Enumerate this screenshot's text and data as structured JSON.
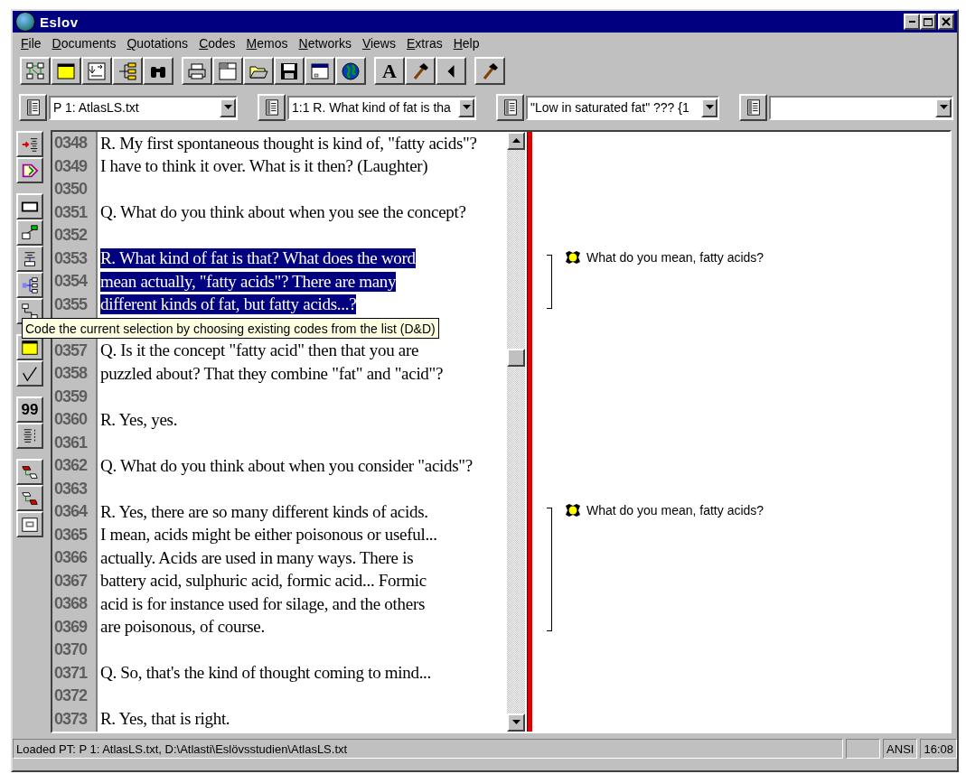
{
  "window": {
    "title": "Eslov"
  },
  "menu": [
    "File",
    "Documents",
    "Quotations",
    "Codes",
    "Memos",
    "Networks",
    "Views",
    "Extras",
    "Help"
  ],
  "toolbar": {
    "font_button": "A"
  },
  "selectors": [
    {
      "kind": "combo",
      "value": "P 1: AtlasLS.txt"
    },
    {
      "kind": "combo",
      "value": "1:1 R. What kind of fat is tha"
    },
    {
      "kind": "combo",
      "value": "\"Low in saturated fat\" ??? {1"
    },
    {
      "kind": "combo"
    }
  ],
  "side_toolbar": {
    "quote_button": "99"
  },
  "tooltip": {
    "text": "Code the current selection by choosing existing codes from the list (D&D)"
  },
  "lines": [
    {
      "number": "0348",
      "text": "R. My first spontaneous thought is kind of, \"fatty acids\"?",
      "selected": false,
      "quoted": false
    },
    {
      "number": "0349",
      "text": "I have to think it over. What is it then? (Laughter)",
      "selected": false,
      "quoted": false
    },
    {
      "number": "0350",
      "selected": false,
      "quoted": false
    },
    {
      "number": "0351",
      "text": "Q. What do you think about when you see the concept?",
      "selected": false,
      "quoted": false
    },
    {
      "number": "0352",
      "selected": false,
      "quoted": false
    },
    {
      "number": "0353",
      "text": "R. What kind of fat is that? What does the word",
      "selected": true,
      "quoted": true,
      "code": "What do you mean, fatty acids?"
    },
    {
      "number": "0354",
      "text": "mean actually, \"fatty acids\"? There are many",
      "selected": true,
      "quoted": true
    },
    {
      "number": "0355",
      "text": "different kinds of fat, but fatty acids...?",
      "selected": true,
      "quoted": true
    },
    {
      "number": "0357",
      "text": "Q. Is it the concept \"fatty acid\" then that you are",
      "selected": false,
      "quoted": false
    },
    {
      "number": "0358",
      "text": "puzzled about? That they combine \"fat\" and \"acid\"?",
      "selected": false,
      "quoted": false
    },
    {
      "number": "0359",
      "selected": false,
      "quoted": false
    },
    {
      "number": "0360",
      "text": "R. Yes, yes.",
      "selected": false,
      "quoted": false
    },
    {
      "number": "0361",
      "selected": false,
      "quoted": false
    },
    {
      "number": "0362",
      "text": "Q. What do you think about when you consider \"acids\"?",
      "selected": false,
      "quoted": false
    },
    {
      "number": "0363",
      "selected": false,
      "quoted": false
    },
    {
      "number": "0364",
      "text": "R. Yes, there are so many different kinds of acids.",
      "selected": false,
      "quoted": true,
      "code": "What do you mean, fatty acids?"
    },
    {
      "number": "0365",
      "text": "I mean, acids might be either poisonous or useful...",
      "selected": false,
      "quoted": true
    },
    {
      "number": "0366",
      "text": "actually. Acids are used in many ways. There is",
      "selected": false,
      "quoted": true
    },
    {
      "number": "0367",
      "text": "battery acid, sulphuric acid, formic acid... Formic",
      "selected": false,
      "quoted": true
    },
    {
      "number": "0368",
      "text": "acid is for instance used for silage, and the others",
      "selected": false,
      "quoted": true
    },
    {
      "number": "0369",
      "text": "are poisonous, of course.",
      "selected": false,
      "quoted": true
    },
    {
      "number": "0370",
      "selected": false,
      "quoted": false
    },
    {
      "number": "0371",
      "text": "Q. So, that's the kind of thought coming to mind...",
      "selected": false,
      "quoted": false
    },
    {
      "number": "0372",
      "selected": false,
      "quoted": false
    },
    {
      "number": "0373",
      "text": "R. Yes, that is right.",
      "selected": false,
      "quoted": false
    }
  ],
  "status_bar": {
    "message": "Loaded PT: P 1: AtlasLS.txt, D:\\Atlasti\\Eslövsstudien\\AtlasLS.txt",
    "encoding": "ANSI",
    "time": "16:08"
  }
}
